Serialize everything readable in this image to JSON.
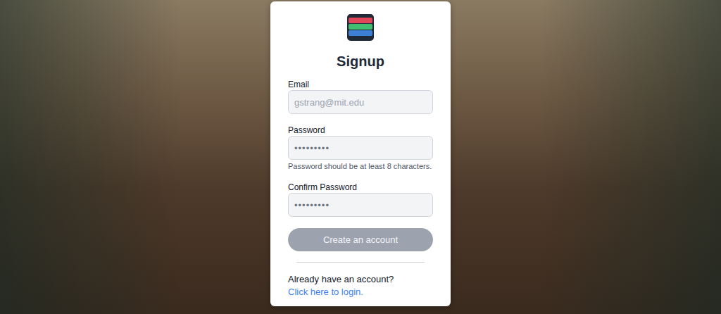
{
  "form": {
    "title": "Signup",
    "fields": [
      {
        "label": "Email",
        "placeholder": "gstrang@mit.edu",
        "hint": ""
      },
      {
        "label": "Password",
        "placeholder": "•••••••••",
        "hint": "Password should be at least 8 characters."
      },
      {
        "label": "Confirm Password",
        "placeholder": "•••••••••",
        "hint": ""
      }
    ],
    "submit": {
      "label": "Create an account",
      "disabled": true
    },
    "footer": {
      "question": "Already have an account?",
      "link": "Click here to login."
    }
  }
}
